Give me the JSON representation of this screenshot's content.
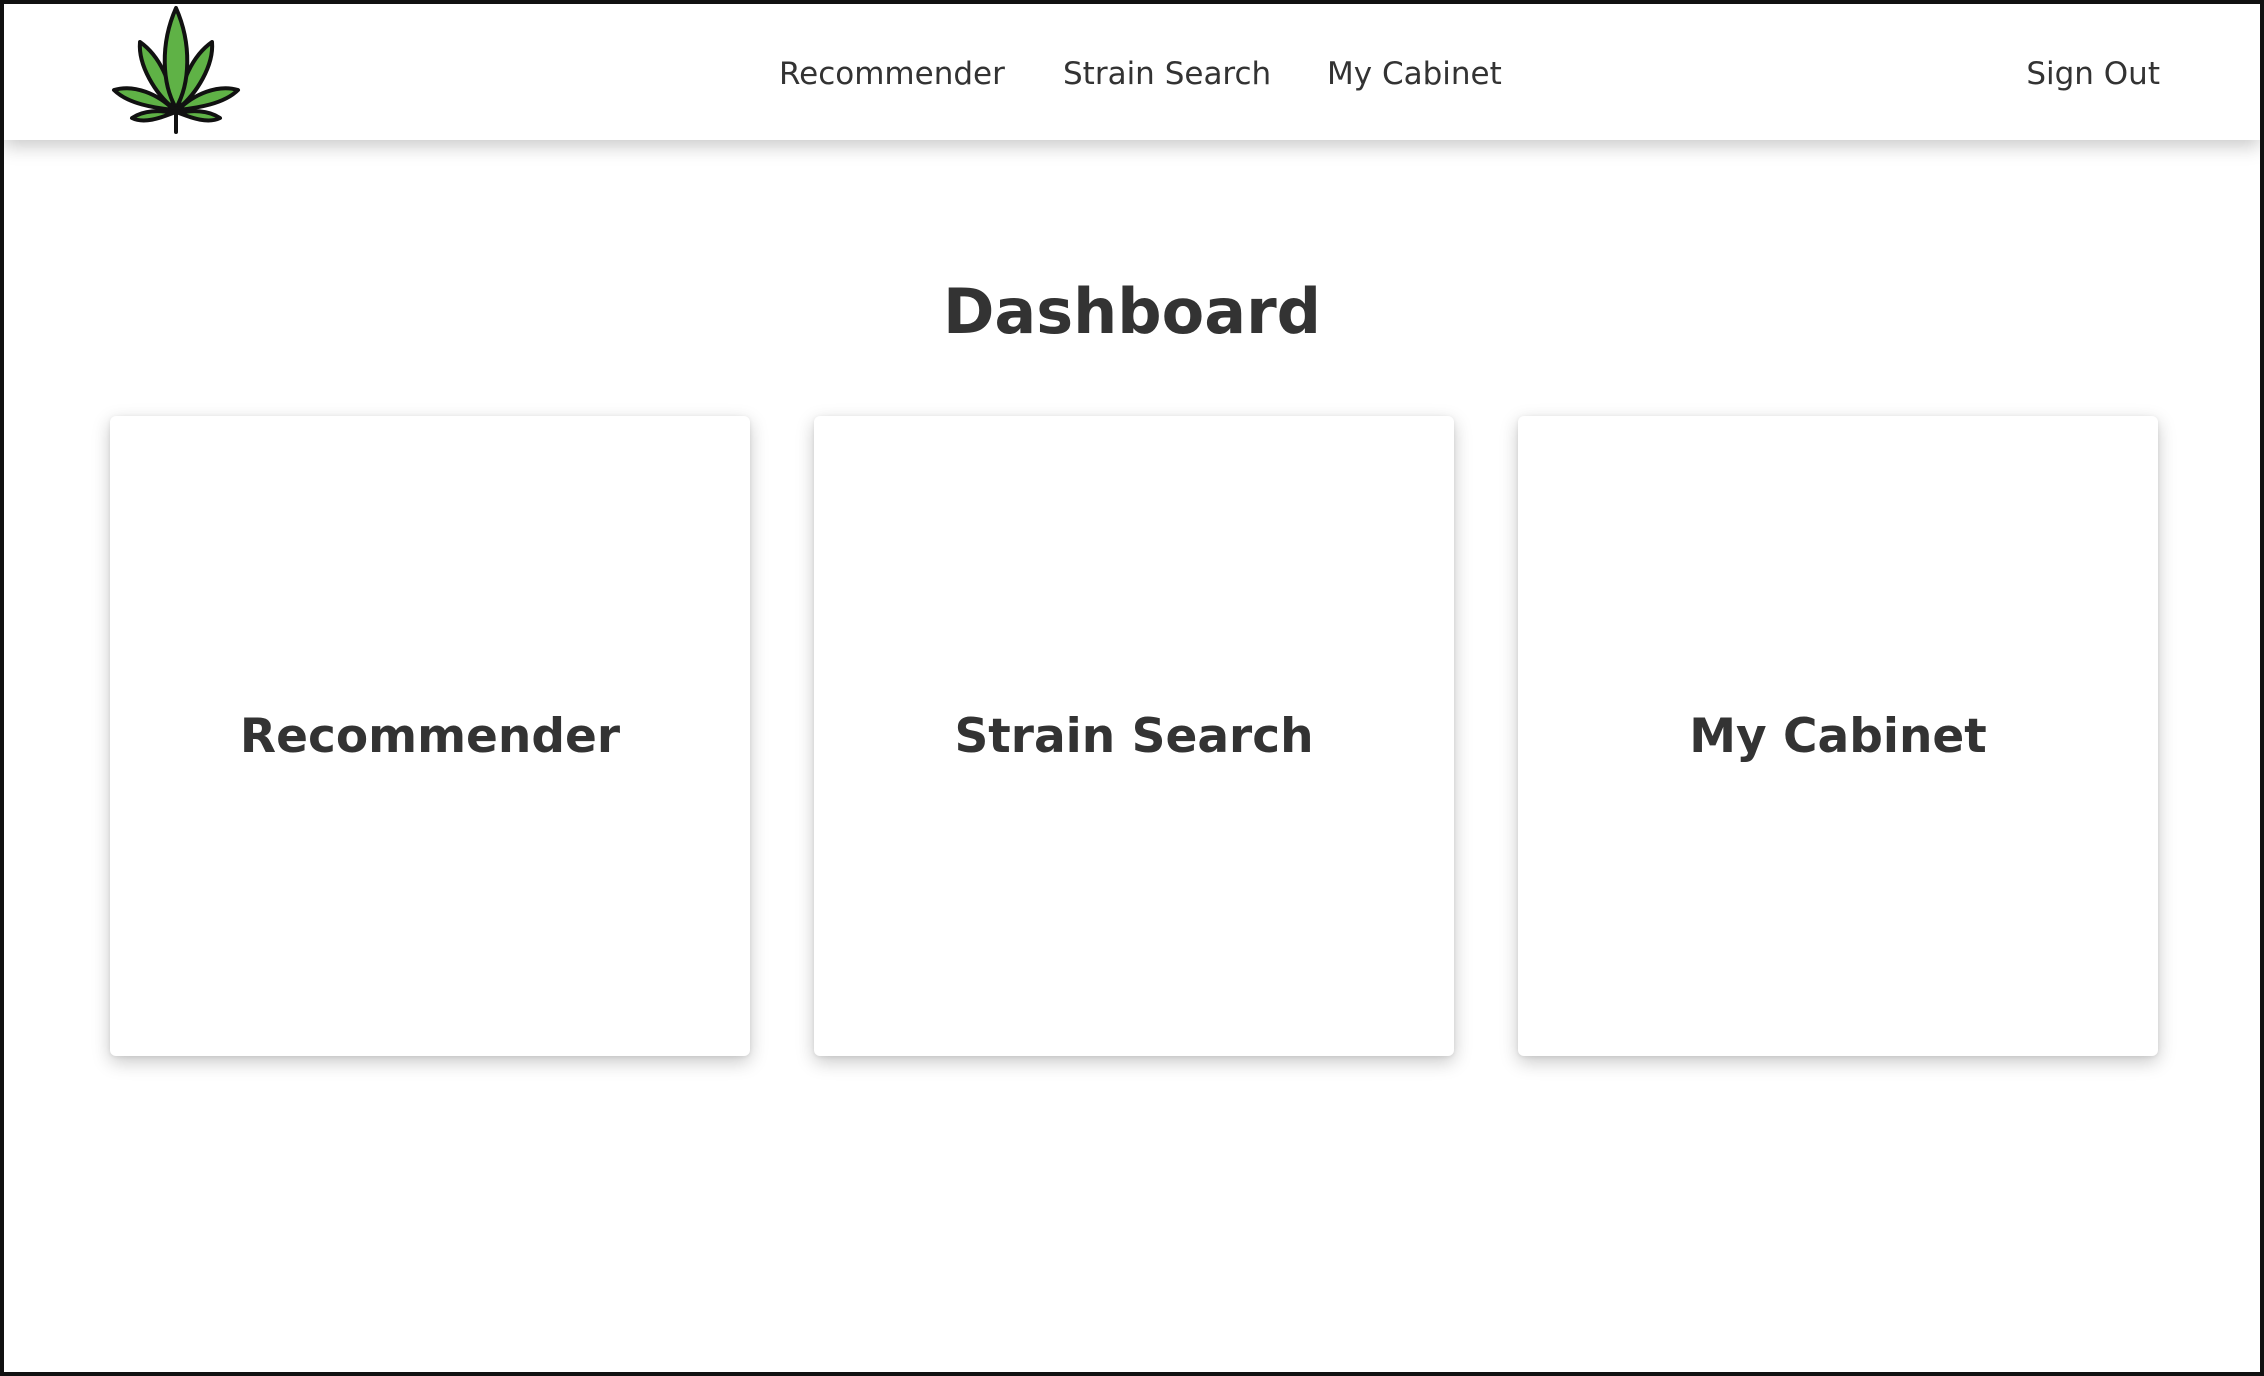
{
  "brand": {
    "logo_icon": "cannabis-leaf-icon",
    "logo_fill": "#5fb246",
    "logo_stroke": "#111111"
  },
  "nav": {
    "links": [
      {
        "label": "Recommender"
      },
      {
        "label": "Strain Search"
      },
      {
        "label": "My Cabinet"
      }
    ],
    "sign_out": "Sign Out"
  },
  "main": {
    "title": "Dashboard",
    "cards": [
      {
        "label": "Recommender"
      },
      {
        "label": "Strain Search"
      },
      {
        "label": "My Cabinet"
      }
    ]
  }
}
